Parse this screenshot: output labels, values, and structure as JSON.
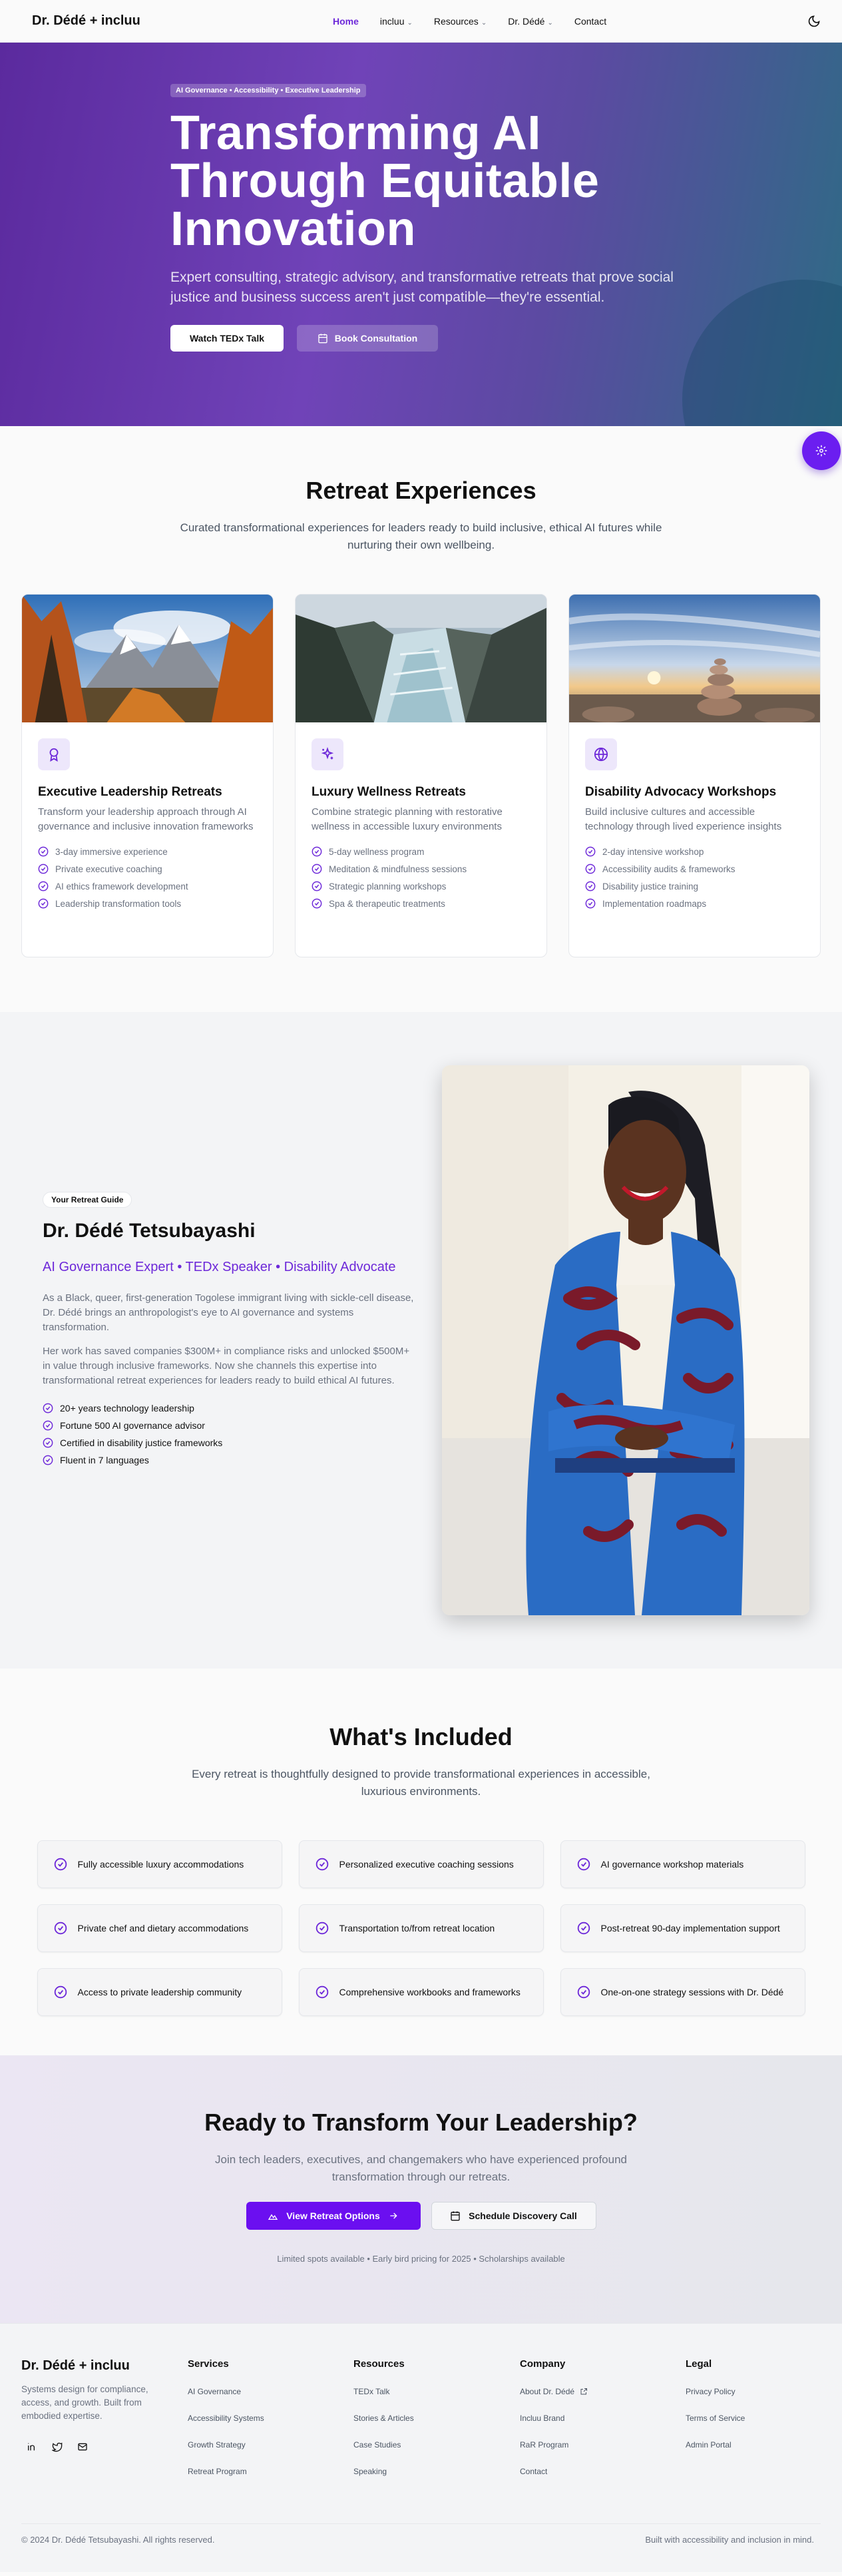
{
  "nav": {
    "brand": "Dr. Dédé + incluu",
    "links": [
      "Home",
      "incluu",
      "Resources",
      "Dr. Dédé",
      "Contact"
    ]
  },
  "hero": {
    "badge": "AI Governance • Accessibility • Executive Leadership",
    "title": "Transforming AI Through Equitable Innovation",
    "subtitle": "Expert consulting, strategic advisory, and transformative retreats that prove social justice and business success aren't just compatible—they're essential.",
    "btn_primary": "Watch TEDx Talk",
    "btn_secondary": "Book Consultation"
  },
  "retreats": {
    "title": "Retreat Experiences",
    "subtitle": "Curated transformational experiences for leaders ready to build inclusive, ethical AI futures while nurturing their own wellbeing.",
    "cards": [
      {
        "icon": "award-icon",
        "title": "Executive Leadership Retreats",
        "desc": "Transform your leadership approach through AI governance and inclusive innovation frameworks",
        "features": [
          "3-day immersive experience",
          "Private executive coaching",
          "AI ethics framework development",
          "Leadership transformation tools"
        ]
      },
      {
        "icon": "sparkles-icon",
        "title": "Luxury Wellness Retreats",
        "desc": "Combine strategic planning with restorative wellness in accessible luxury environments",
        "features": [
          "5-day wellness program",
          "Meditation & mindfulness sessions",
          "Strategic planning workshops",
          "Spa & therapeutic treatments"
        ]
      },
      {
        "icon": "globe-icon",
        "title": "Disability Advocacy Workshops",
        "desc": "Build inclusive cultures and accessible technology through lived experience insights",
        "features": [
          "2-day intensive workshop",
          "Accessibility audits & frameworks",
          "Disability justice training",
          "Implementation roadmaps"
        ]
      }
    ]
  },
  "about": {
    "badge": "Your Retreat Guide",
    "name": "Dr. Dédé Tetsubayashi",
    "tagline": "AI Governance Expert • TEDx Speaker • Disability Advocate",
    "p1": "As a Black, queer, first-generation Togolese immigrant living with sickle-cell disease, Dr. Dédé brings an anthropologist's eye to AI governance and systems transformation.",
    "p2": "Her work has saved companies $300M+ in compliance risks and unlocked $500M+ in value through inclusive frameworks. Now she channels this expertise into transformational retreat experiences for leaders ready to build ethical AI futures.",
    "credentials": [
      "20+ years technology leadership",
      "Fortune 500 AI governance advisor",
      "Certified in disability justice frameworks",
      "Fluent in 7 languages"
    ]
  },
  "included": {
    "title": "What's Included",
    "subtitle": "Every retreat is thoughtfully designed to provide transformational experiences in accessible, luxurious environments.",
    "items": [
      "Fully accessible luxury accommodations",
      "Personalized executive coaching sessions",
      "AI governance workshop materials",
      "Private chef and dietary accommodations",
      "Transportation to/from retreat location",
      "Post-retreat 90-day implementation support",
      "Access to private leadership community",
      "Comprehensive workbooks and frameworks",
      "One-on-one strategy sessions with Dr. Dédé"
    ]
  },
  "cta": {
    "title": "Ready to Transform Your Leadership?",
    "subtitle": "Join tech leaders, executives, and changemakers who have experienced profound transformation through our retreats.",
    "btn_primary": "View Retreat Options",
    "btn_secondary": "Schedule Discovery Call",
    "note": "Limited spots available • Early bird pricing for 2025 • Scholarships available"
  },
  "footer": {
    "brand": "Dr. Dédé + incluu",
    "desc": "Systems design for compliance, access, and growth. Built from embodied expertise.",
    "columns": [
      {
        "title": "Services",
        "links": [
          "AI Governance",
          "Accessibility Systems",
          "Growth Strategy",
          "Retreat Program"
        ]
      },
      {
        "title": "Resources",
        "links": [
          "TEDx Talk",
          "Stories & Articles",
          "Case Studies",
          "Speaking"
        ]
      },
      {
        "title": "Company",
        "links": [
          "About Dr. Dédé",
          "Incluu Brand",
          "RaR Program",
          "Contact"
        ]
      },
      {
        "title": "Legal",
        "links": [
          "Privacy Policy",
          "Terms of Service",
          "Admin Portal"
        ]
      }
    ],
    "copyright": "© 2024 Dr. Dédé Tetsubayashi. All rights reserved.",
    "tagline": "Built with accessibility and inclusion in mind."
  },
  "colors": {
    "accent": "#6d28d9",
    "primary_button": "#6b0ff0",
    "hero_start": "#5b2a9e",
    "hero_end": "#2e6b85"
  }
}
